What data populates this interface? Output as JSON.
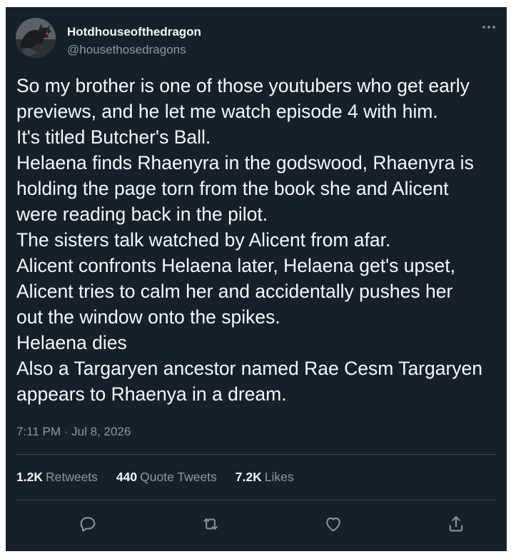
{
  "tweet": {
    "author": {
      "display_name": "Hotdhouseofthedragon",
      "handle": "@housethosedragons",
      "avatar_icon": "dragon-avatar"
    },
    "more_icon": "more-options-icon",
    "text_lines": [
      "So my brother is one of those youtubers who get early",
      "previews, and he let me watch episode 4 with him.",
      "It's titled Butcher's Ball.",
      "Helaena finds Rhaenyra in the godswood, Rhaenyra is",
      "holding the page torn from the book she and Alicent",
      "were reading back in the pilot.",
      "The sisters talk watched by Alicent from afar.",
      "Alicent confronts Helaena later, Helaena get's upset,",
      "Alicent tries to calm her and accidentally pushes her",
      "out the window onto the spikes.",
      "Helaena dies",
      "Also a Targaryen ancestor named Rae Cesm Targaryen",
      "appears to Rhaenya in a dream."
    ],
    "timestamp": "7:11 PM · Jul 8, 2026",
    "stats": {
      "retweets_count": "1.2K",
      "retweets_label": "Retweets",
      "quotes_count": "440",
      "quotes_label": "Quote Tweets",
      "likes_count": "7.2K",
      "likes_label": "Likes"
    },
    "actions": [
      "reply-icon",
      "retweet-icon",
      "like-icon",
      "share-icon"
    ]
  },
  "colors": {
    "background": "#15202b",
    "text_primary": "#f7f9f9",
    "text_secondary": "#8b98a5",
    "divider": "#38444d"
  }
}
